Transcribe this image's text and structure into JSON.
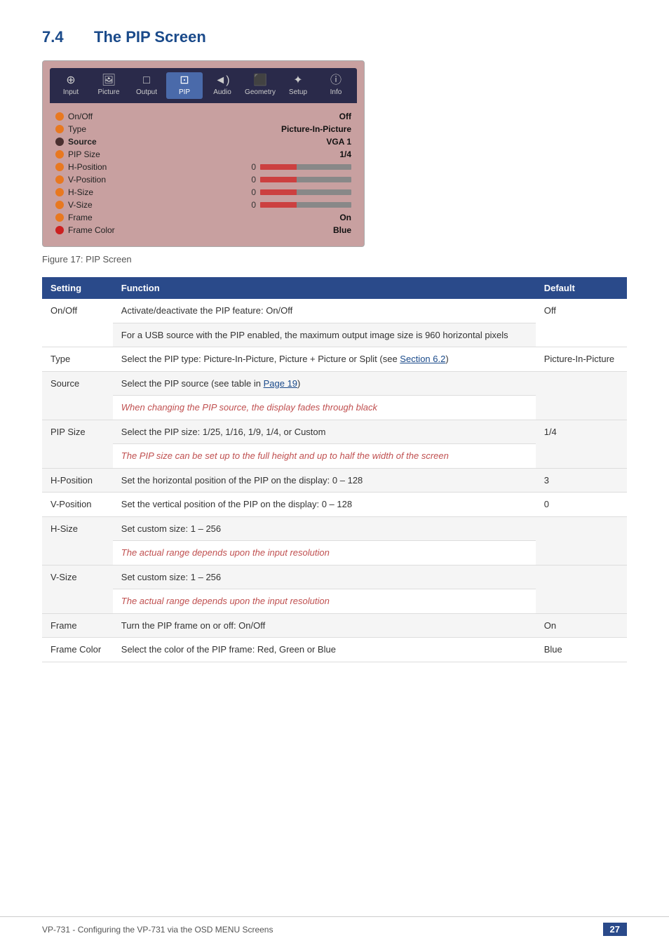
{
  "section": {
    "number": "7.4",
    "title": "The PIP Screen"
  },
  "osd": {
    "menu_items": [
      {
        "label": "Input",
        "icon": "🔍",
        "active": false
      },
      {
        "label": "Picture",
        "icon": "🖼",
        "active": false
      },
      {
        "label": "Output",
        "icon": "⬜",
        "active": false
      },
      {
        "label": "PIP",
        "icon": "⬜",
        "active": true
      },
      {
        "label": "Audio",
        "icon": "🔊",
        "active": false
      },
      {
        "label": "Geometry",
        "icon": "⬛",
        "active": false
      },
      {
        "label": "Setup",
        "icon": "✳",
        "active": false
      },
      {
        "label": "Info",
        "icon": "ℹ",
        "active": false
      }
    ],
    "rows": [
      {
        "label": "On/Off",
        "value": "Off",
        "bullet": "orange",
        "type": "value"
      },
      {
        "label": "Type",
        "value": "Picture-In-Picture",
        "bullet": "orange",
        "type": "value"
      },
      {
        "label": "Source",
        "value": "VGA 1",
        "bullet": "dark",
        "type": "value",
        "bold": true
      },
      {
        "label": "PIP Size",
        "value": "1/4",
        "bullet": "orange",
        "type": "value"
      },
      {
        "label": "H-Position",
        "num": "0",
        "bullet": "orange",
        "type": "bar"
      },
      {
        "label": "V-Position",
        "num": "0",
        "bullet": "orange",
        "type": "bar"
      },
      {
        "label": "H-Size",
        "num": "0",
        "bullet": "orange",
        "type": "bar"
      },
      {
        "label": "V-Size",
        "num": "0",
        "bullet": "orange",
        "type": "bar"
      },
      {
        "label": "Frame",
        "value": "On",
        "bullet": "orange",
        "type": "value"
      },
      {
        "label": "Frame Color",
        "value": "Blue",
        "bullet": "red",
        "type": "value"
      }
    ]
  },
  "figure_caption": "Figure 17: PIP Screen",
  "table": {
    "headers": [
      "Setting",
      "Function",
      "Default"
    ],
    "rows": [
      {
        "setting": "On/Off",
        "functions": [
          {
            "text": "Activate/deactivate the PIP feature: On/Off",
            "italic": false
          },
          {
            "text": "For a USB source with the PIP enabled, the maximum output image size is 960 horizontal pixels",
            "italic": false
          }
        ],
        "default": "Off"
      },
      {
        "setting": "Type",
        "functions": [
          {
            "text": "Select the PIP type: Picture-In-Picture, Picture + Picture or Split (see Section 6.2)",
            "italic": false,
            "link": "Section 6.2"
          }
        ],
        "default": "Picture-In-Picture"
      },
      {
        "setting": "Source",
        "functions": [
          {
            "text": "Select the PIP source (see table in Page 19)",
            "italic": false,
            "link": "Page 19"
          },
          {
            "text": "When changing the PIP source, the display fades through black",
            "italic": true
          }
        ],
        "default": ""
      },
      {
        "setting": "PIP Size",
        "functions": [
          {
            "text": "Select the PIP size: 1/25, 1/16, 1/9, 1/4, or Custom",
            "italic": false
          },
          {
            "text": "The PIP size can be set up to the full height and up to half the width of the screen",
            "italic": true
          }
        ],
        "default": "1/4"
      },
      {
        "setting": "H-Position",
        "functions": [
          {
            "text": "Set the horizontal position of the PIP on the display: 0 – 128",
            "italic": false
          }
        ],
        "default": "3"
      },
      {
        "setting": "V-Position",
        "functions": [
          {
            "text": "Set the vertical position of the PIP on the display: 0 – 128",
            "italic": false
          }
        ],
        "default": "0"
      },
      {
        "setting": "H-Size",
        "functions": [
          {
            "text": "Set custom size: 1 – 256",
            "italic": false
          },
          {
            "text": "The actual range depends upon the input resolution",
            "italic": true
          }
        ],
        "default": ""
      },
      {
        "setting": "V-Size",
        "functions": [
          {
            "text": "Set custom size: 1 – 256",
            "italic": false
          },
          {
            "text": "The actual range depends upon the input resolution",
            "italic": true
          }
        ],
        "default": ""
      },
      {
        "setting": "Frame",
        "functions": [
          {
            "text": "Turn the PIP frame on or off: On/Off",
            "italic": false
          }
        ],
        "default": "On"
      },
      {
        "setting": "Frame Color",
        "functions": [
          {
            "text": "Select the color of the PIP frame: Red, Green or Blue",
            "italic": false
          }
        ],
        "default": "Blue"
      }
    ]
  },
  "footer": {
    "text": "VP-731 - Configuring the VP-731 via the OSD MENU Screens",
    "page": "27"
  }
}
